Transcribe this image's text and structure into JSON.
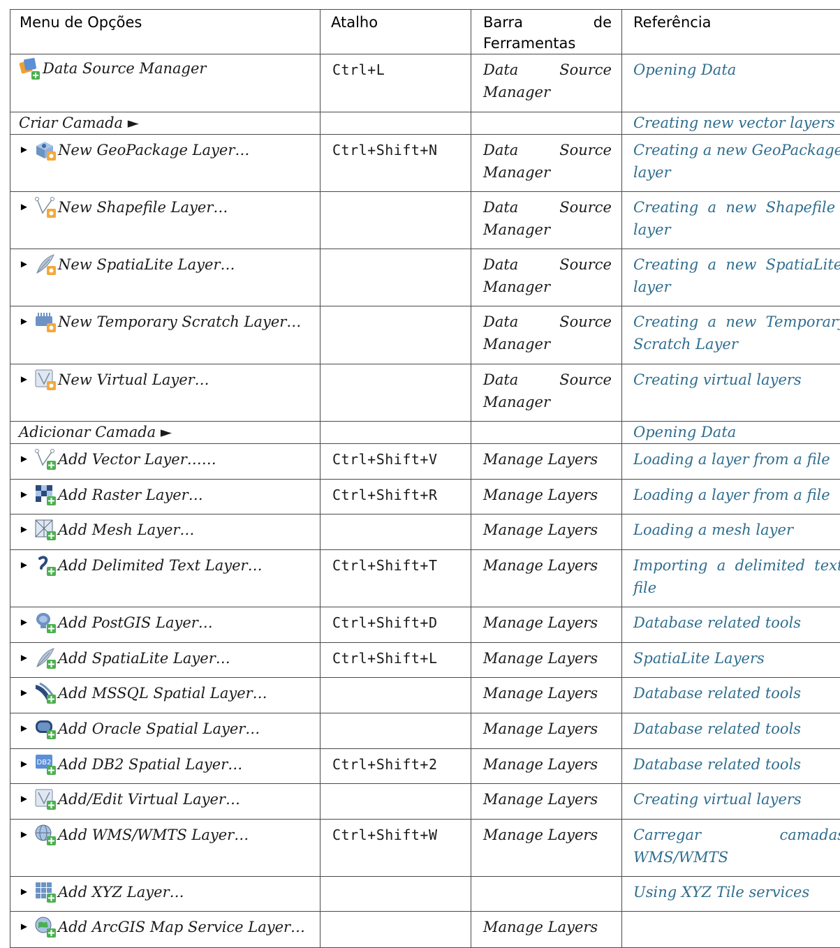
{
  "headers": {
    "menu": "Menu de Opções",
    "shortcut": "Atalho",
    "toolbar_line1_a": "Barra",
    "toolbar_line1_b": "de",
    "toolbar_line2": "Ferramentas",
    "reference": "Referência"
  },
  "rows": [
    {
      "label": "Data Source Manager",
      "icon": "data-source-manager-icon",
      "shortcut": "Ctrl+L",
      "toolbar_a": "Data",
      "toolbar_b": "Source",
      "toolbar_c": "Manager",
      "ref1": "Opening Data",
      "ref2": ""
    },
    {
      "label": "Criar Camada ►",
      "icon": "",
      "shortcut": "",
      "toolbar_a": "",
      "toolbar_b": "",
      "toolbar_c": "",
      "ref1": "Creating new vector layers",
      "ref2": ""
    },
    {
      "label": "New GeoPackage Layer…",
      "icon": "geopackage-icon",
      "shortcut": "Ctrl+Shift+N",
      "toolbar_a": "Data",
      "toolbar_b": "Source",
      "toolbar_c": "Manager",
      "ref1": "Creating a new GeoPackage",
      "ref2": "layer"
    },
    {
      "label": "New Shapefile Layer…",
      "icon": "shapefile-icon",
      "shortcut": "",
      "toolbar_a": "Data",
      "toolbar_b": "Source",
      "toolbar_c": "Manager",
      "ref1": "Creating  a  new  Shapefile",
      "ref2": "layer"
    },
    {
      "label": "New SpatiaLite Layer…",
      "icon": "spatialite-icon",
      "shortcut": "",
      "toolbar_a": "Data",
      "toolbar_b": "Source",
      "toolbar_c": "Manager",
      "ref1": "Creating  a  new  SpatiaLite",
      "ref2": "layer"
    },
    {
      "label": "New Temporary Scratch Layer…",
      "icon": "temporary-scratch-icon",
      "shortcut": "",
      "toolbar_a": "Data",
      "toolbar_b": "Source",
      "toolbar_c": "Manager",
      "ref1": "Creating  a  new  Temporary",
      "ref2": "Scratch Layer"
    },
    {
      "label": "New Virtual Layer…",
      "icon": "virtual-layer-icon",
      "shortcut": "",
      "toolbar_a": "Data",
      "toolbar_b": "Source",
      "toolbar_c": "Manager",
      "ref1": "Creating virtual layers",
      "ref2": ""
    },
    {
      "label": "Adicionar Camada ►",
      "icon": "",
      "shortcut": "",
      "toolbar_a": "",
      "toolbar_b": "",
      "toolbar_c": "",
      "ref1": "Opening Data",
      "ref2": ""
    },
    {
      "label": "Add Vector Layer……",
      "icon": "add-vector-icon",
      "shortcut": "Ctrl+Shift+V",
      "toolbar": "Manage Layers",
      "ref1": "Loading a layer from a file",
      "ref2": ""
    },
    {
      "label": "Add Raster Layer…",
      "icon": "add-raster-icon",
      "shortcut": "Ctrl+Shift+R",
      "toolbar": "Manage Layers",
      "ref1": "Loading a layer from a file",
      "ref2": ""
    },
    {
      "label": "Add Mesh Layer…",
      "icon": "add-mesh-icon",
      "shortcut": "",
      "toolbar": "Manage Layers",
      "ref1": "Loading a mesh layer",
      "ref2": ""
    },
    {
      "label": "Add Delimited Text Layer…",
      "icon": "add-delimited-text-icon",
      "shortcut": "Ctrl+Shift+T",
      "toolbar": "Manage Layers",
      "ref1": "Importing  a  delimited  text",
      "ref2": "file"
    },
    {
      "label": "Add PostGIS Layer…",
      "icon": "add-postgis-icon",
      "shortcut": "Ctrl+Shift+D",
      "toolbar": "Manage Layers",
      "ref1": "Database related tools",
      "ref2": ""
    },
    {
      "label": "Add SpatiaLite Layer…",
      "icon": "add-spatialite-icon",
      "shortcut": "Ctrl+Shift+L",
      "toolbar": "Manage Layers",
      "ref1": "SpatiaLite Layers",
      "ref2": ""
    },
    {
      "label": "Add MSSQL Spatial Layer…",
      "icon": "add-mssql-icon",
      "shortcut": "",
      "toolbar": "Manage Layers",
      "ref1": "Database related tools",
      "ref2": ""
    },
    {
      "label": "Add Oracle Spatial Layer…",
      "icon": "add-oracle-icon",
      "shortcut": "",
      "toolbar": "Manage Layers",
      "ref1": "Database related tools",
      "ref2": ""
    },
    {
      "label": "Add DB2 Spatial Layer…",
      "icon": "add-db2-icon",
      "shortcut": "Ctrl+Shift+2",
      "toolbar": "Manage Layers",
      "ref1": "Database related tools",
      "ref2": ""
    },
    {
      "label": "Add/Edit Virtual Layer…",
      "icon": "add-virtual-icon",
      "shortcut": "",
      "toolbar": "Manage Layers",
      "ref1": "Creating virtual layers",
      "ref2": ""
    },
    {
      "label": "Add WMS/WMTS Layer…",
      "icon": "add-wms-icon",
      "shortcut": "Ctrl+Shift+W",
      "toolbar": "Manage Layers",
      "ref1a": "Carregar",
      "ref1b": "camadas",
      "ref2": "WMS/WMTS"
    },
    {
      "label": "Add XYZ Layer…",
      "icon": "add-xyz-icon",
      "shortcut": "",
      "toolbar": "",
      "ref1": "Using XYZ Tile services",
      "ref2": ""
    },
    {
      "label": "Add ArcGIS Map Service Layer…",
      "icon": "add-arcgis-icon",
      "shortcut": "",
      "toolbar": "Manage Layers",
      "ref1": "",
      "ref2": ""
    }
  ],
  "colors": {
    "link": "#2f6d8e",
    "border": "#4a4a4a"
  }
}
